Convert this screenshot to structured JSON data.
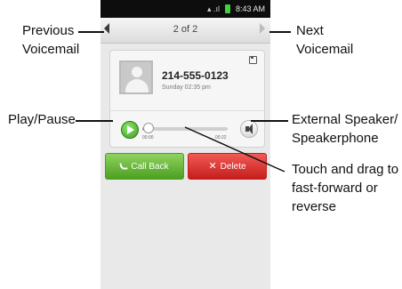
{
  "callouts": {
    "previous": [
      "Previous",
      "Voicemail"
    ],
    "next": [
      "Next",
      "Voicemail"
    ],
    "play": "Play/Pause",
    "speaker": [
      "External Speaker/",
      "Speakerphone"
    ],
    "drag": [
      "Touch and drag to",
      "fast-forward or",
      "reverse"
    ]
  },
  "status_bar": {
    "time": "8:43 AM"
  },
  "nav": {
    "counter": "2 of 2"
  },
  "voicemail": {
    "number": "214-555-0123",
    "timestamp": "Sunday 02:35 pm",
    "elapsed": "00:00",
    "duration": "00:22",
    "progress": 0.05
  },
  "actions": {
    "call_back": "Call Back",
    "delete": "Delete"
  },
  "colors": {
    "call_back": "#4c9f21",
    "delete": "#c51f1c",
    "play": "#3d9c1f"
  },
  "icons": {
    "previous": "triangle-left-icon",
    "next": "triangle-right-icon",
    "play": "play-icon",
    "speaker": "speaker-icon",
    "save": "save-icon",
    "call": "phone-icon",
    "delete": "x-icon"
  }
}
